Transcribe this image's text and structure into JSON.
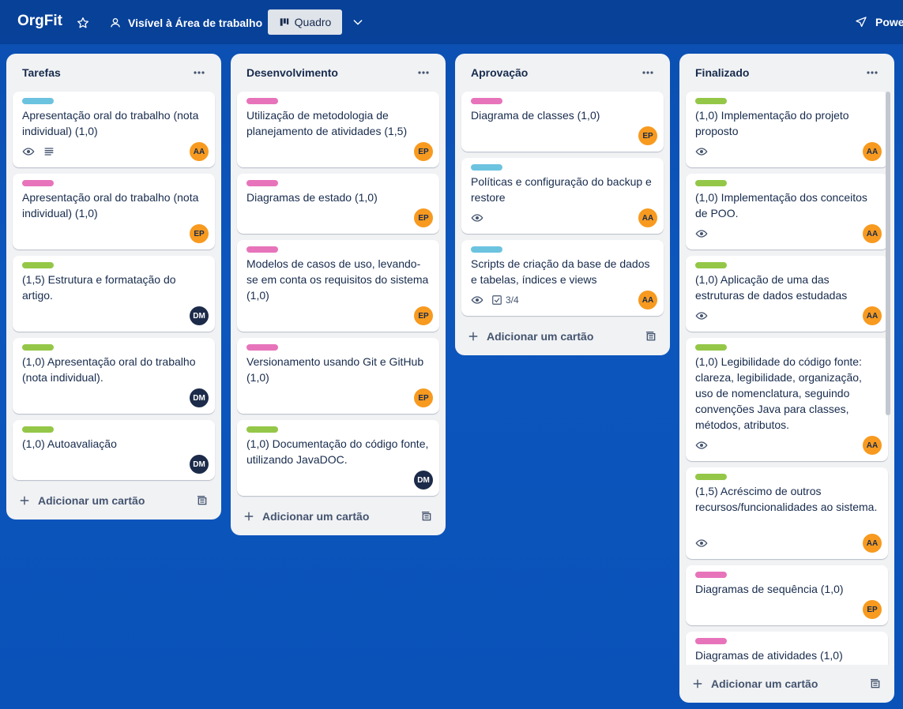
{
  "header": {
    "board_name": "OrgFit",
    "visibility_label": "Visível à Área de trabalho",
    "view_label": "Quadro",
    "power_ups_label": "Powe"
  },
  "colors": {
    "label_teal": "#6cc3e0",
    "label_pink": "#e774bb",
    "label_green": "#94c748",
    "avatar_orange": "#f79a1f",
    "avatar_dark": "#1d2b4a"
  },
  "add_card_label": "Adicionar um cartão",
  "lists": [
    {
      "title": "Tarefas",
      "cards": [
        {
          "label": "teal",
          "title": "Apresentação oral do trabalho (nota individual) (1,0)",
          "avatar": "AA",
          "badges": [
            "eye-icon",
            "description-icon"
          ]
        },
        {
          "label": "pink",
          "title": "Apresentação oral do trabalho (nota individual) (1,0)",
          "avatar": "EP"
        },
        {
          "label": "green",
          "title": "(1,5) Estrutura e formatação do artigo.",
          "avatar": "DM"
        },
        {
          "label": "green",
          "title": "(1,0) Apresentação oral do trabalho (nota individual).",
          "avatar": "DM"
        },
        {
          "label": "green",
          "title": "(1,0) Autoavaliação",
          "avatar": "DM"
        }
      ]
    },
    {
      "title": "Desenvolvimento",
      "cards": [
        {
          "label": "pink",
          "title": "Utilização de metodologia de planejamento de atividades (1,5)",
          "avatar": "EP"
        },
        {
          "label": "pink",
          "title": "Diagramas de estado (1,0)",
          "avatar": "EP"
        },
        {
          "label": "pink",
          "title": "Modelos de casos de uso, levando-se em conta os requisitos do sistema (1,0)",
          "avatar": "EP"
        },
        {
          "label": "pink",
          "title": "Versionamento usando Git e GitHub (1,0)",
          "avatar": "EP"
        },
        {
          "label": "green",
          "title": "(1,0) Documentação do código fonte, utilizando JavaDOC.",
          "avatar": "DM"
        }
      ]
    },
    {
      "title": "Aprovação",
      "cards": [
        {
          "label": "pink",
          "title": "Diagrama de classes (1,0)",
          "avatar": "EP"
        },
        {
          "label": "teal",
          "title": "Políticas e configuração do backup e restore",
          "avatar": "AA",
          "badges": [
            "eye-icon"
          ]
        },
        {
          "label": "teal",
          "title": "Scripts de criação da base de dados e tabelas, índices e views",
          "avatar": "AA",
          "badges": [
            "eye-icon",
            "checklist-icon"
          ],
          "checklist": "3/4"
        }
      ]
    },
    {
      "title": "Finalizado",
      "cards": [
        {
          "label": "green",
          "title": "(1,0) Implementação do projeto proposto",
          "avatar": "AA",
          "badges": [
            "eye-icon"
          ]
        },
        {
          "label": "green",
          "title": "(1,0) Implementação dos conceitos de POO.",
          "avatar": "AA",
          "badges": [
            "eye-icon"
          ]
        },
        {
          "label": "green",
          "title": "(1,0) Aplicação de uma das estruturas de dados estudadas",
          "avatar": "AA",
          "badges": [
            "eye-icon"
          ]
        },
        {
          "label": "green",
          "title": "(1,0) Legibilidade do código fonte: clareza, legibilidade, organização, uso de nomenclatura, seguindo convenções Java para classes, métodos, atributos.",
          "avatar": "AA",
          "badges": [
            "eye-icon"
          ]
        },
        {
          "label": "green",
          "title": "(1,5) Acréscimo de outros recursos/funcionalidades ao sistema.",
          "avatar": "AA",
          "badges": [
            "eye-icon"
          ]
        },
        {
          "label": "pink",
          "title": "Diagramas de sequência (1,0)",
          "avatar": "EP"
        },
        {
          "label": "pink",
          "title": "Diagramas de atividades (1,0)"
        }
      ]
    }
  ]
}
